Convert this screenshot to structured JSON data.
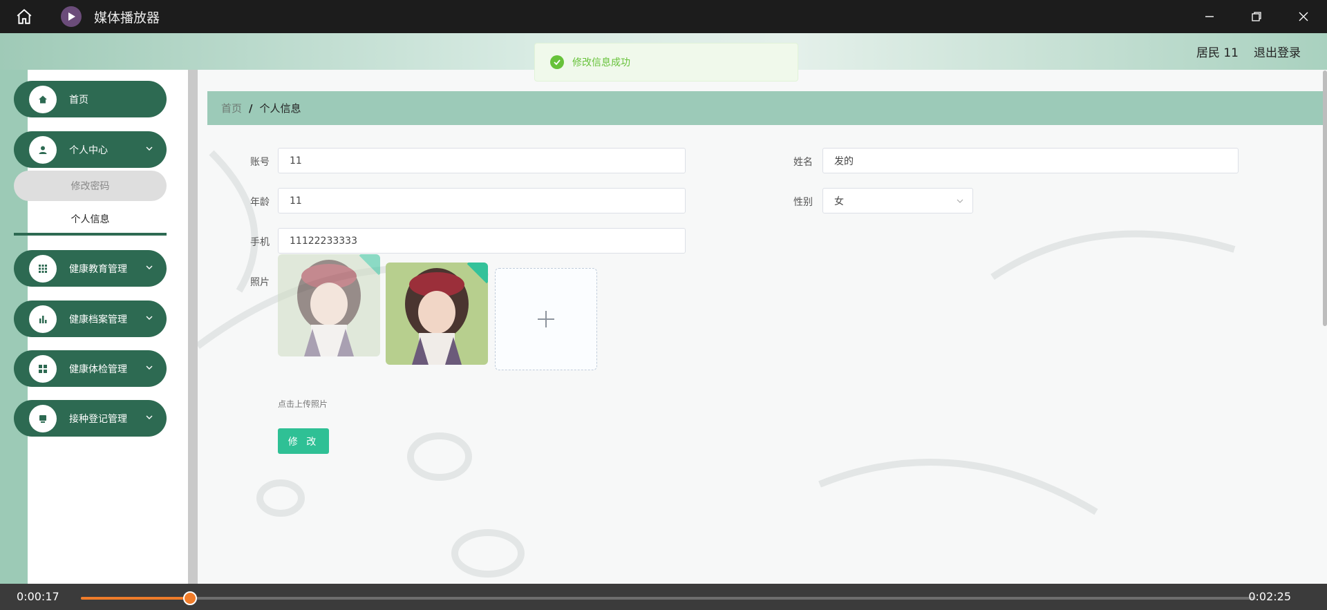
{
  "player": {
    "title": "媒体播放器",
    "current_time": "0:00:17",
    "end_time": "0:02:25",
    "progress_fraction": 0.093
  },
  "app": {
    "user_label": "居民 11",
    "logout_label": "退出登录",
    "toast_message": "修改信息成功"
  },
  "sidebar": {
    "items": [
      {
        "label": "首页",
        "icon": "home-icon"
      },
      {
        "label": "个人中心",
        "icon": "user-icon"
      },
      {
        "label": "健康教育管理",
        "icon": "grid-icon"
      },
      {
        "label": "健康档案管理",
        "icon": "bar-chart-icon"
      },
      {
        "label": "健康体检管理",
        "icon": "apps-icon"
      },
      {
        "label": "接种登记管理",
        "icon": "monitor-icon"
      }
    ],
    "sub_items": [
      {
        "label": "修改密码"
      },
      {
        "label": "个人信息"
      }
    ]
  },
  "breadcrumb": {
    "home": "首页",
    "separator": "/",
    "current": "个人信息"
  },
  "form": {
    "account_label": "账号",
    "account_value": "11",
    "name_label": "姓名",
    "name_value": "发的",
    "age_label": "年龄",
    "age_value": "11",
    "gender_label": "性别",
    "gender_value": "女",
    "phone_label": "手机",
    "phone_value": "11122233333",
    "photo_label": "照片",
    "upload_hint": "点击上传照片",
    "submit_label": "修 改"
  },
  "colors": {
    "accent_green": "#2d6a52",
    "breadcrumb_bg": "#9ccab8",
    "submit_bg": "#2fc095",
    "progress_orange": "#f07c2a",
    "toast_green": "#67c23a"
  }
}
